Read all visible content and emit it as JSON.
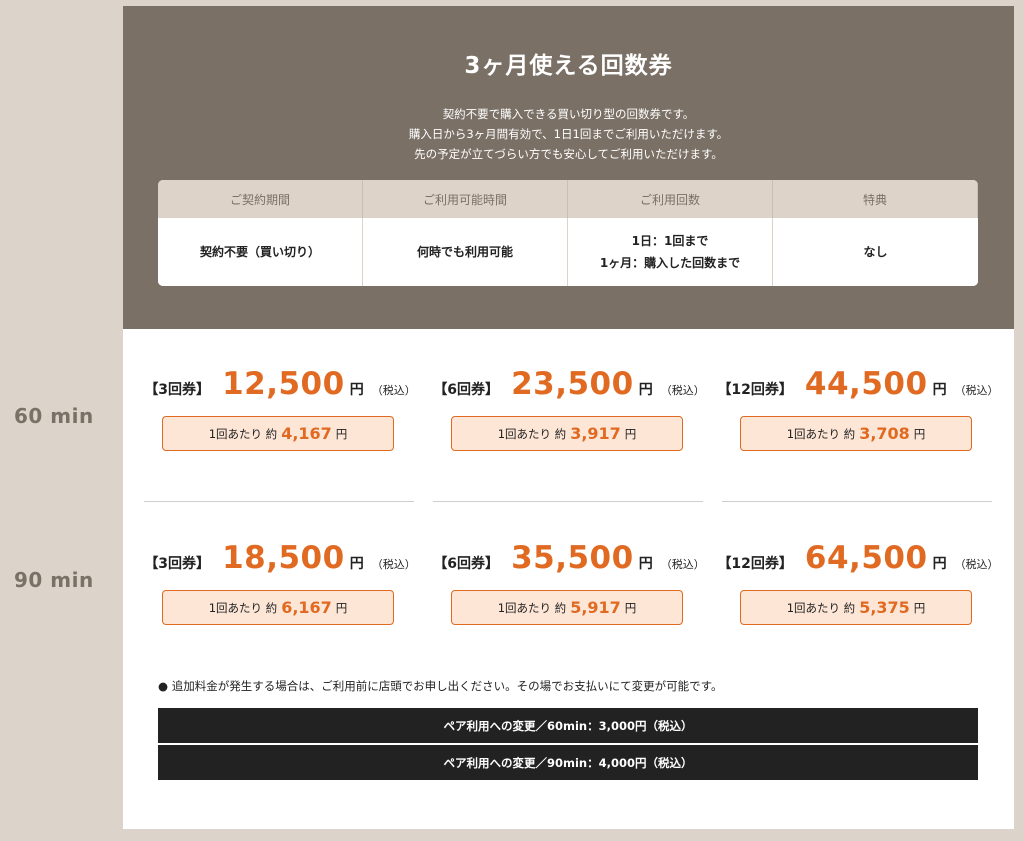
{
  "side_labels": {
    "row1": "60 min",
    "row2": "90 min"
  },
  "header": {
    "title": "3ヶ月使える回数券",
    "description": [
      "契約不要で購入できる買い切り型の回数券です。",
      "購入日から3ヶ月間有効で、1日1回までご利用いただけます。",
      "先の予定が立てづらい方でも安心してご利用いただけます。"
    ]
  },
  "info_table": {
    "headers": [
      "ご契約期間",
      "ご利用可能時間",
      "ご利用回数",
      "特典"
    ],
    "values": [
      "契約不要（買い切り）",
      "何時でも利用可能",
      "1日：1回まで",
      "なし"
    ],
    "values_extra": "1ヶ月：購入した回数まで"
  },
  "prices": {
    "row1": [
      {
        "ticket": "【3回券】",
        "amount": "12,500",
        "unit": "円",
        "tax": "（税込）",
        "per_prefix": "1回あたり 約",
        "per_value": "4,167",
        "per_unit": "円"
      },
      {
        "ticket": "【6回券】",
        "amount": "23,500",
        "unit": "円",
        "tax": "（税込）",
        "per_prefix": "1回あたり 約",
        "per_value": "3,917",
        "per_unit": "円"
      },
      {
        "ticket": "【12回券】",
        "amount": "44,500",
        "unit": "円",
        "tax": "（税込）",
        "per_prefix": "1回あたり 約",
        "per_value": "3,708",
        "per_unit": "円"
      }
    ],
    "row2": [
      {
        "ticket": "【3回券】",
        "amount": "18,500",
        "unit": "円",
        "tax": "（税込）",
        "per_prefix": "1回あたり 約",
        "per_value": "6,167",
        "per_unit": "円"
      },
      {
        "ticket": "【6回券】",
        "amount": "35,500",
        "unit": "円",
        "tax": "（税込）",
        "per_prefix": "1回あたり 約",
        "per_value": "5,917",
        "per_unit": "円"
      },
      {
        "ticket": "【12回券】",
        "amount": "64,500",
        "unit": "円",
        "tax": "（税込）",
        "per_prefix": "1回あたり 約",
        "per_value": "5,375",
        "per_unit": "円"
      }
    ]
  },
  "note": "● 追加料金が発生する場合は、ご利用前に店頭でお申し出ください。その場でお支払いにて変更が可能です。",
  "pair_options": [
    "ペア利用への変更／60min：3,000円（税込）",
    "ペア利用への変更／90min：4,000円（税込）"
  ],
  "colors": {
    "header_bg": "#7a7066",
    "accent_orange": "#e06a22",
    "price_box_bg": "#fde6d6",
    "page_bg": "#dcd4ca",
    "dark_bar": "#222222"
  }
}
